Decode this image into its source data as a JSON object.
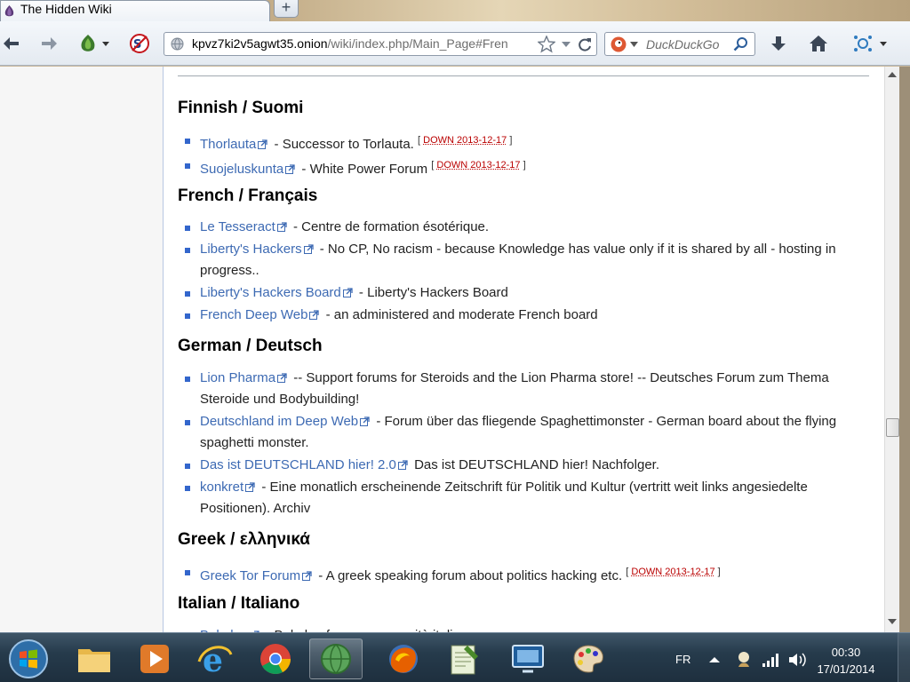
{
  "tab": {
    "title": "The Hidden Wiki",
    "new_tab_label": "+"
  },
  "navbar": {
    "url_host": "kpvz7ki2v5agwt35.onion",
    "url_path": "/wiki/index.php/Main_Page#Fren",
    "search_placeholder": "DuckDuckGo"
  },
  "sections": [
    {
      "heading": "Finnish / Suomi",
      "items": [
        {
          "link": "Thorlauta",
          "desc": " - Successor to Torlauta. ",
          "badge": "DOWN 2013-12-17"
        },
        {
          "link": "Suojeluskunta",
          "desc": " - White Power Forum ",
          "badge": "DOWN 2013-12-17"
        }
      ]
    },
    {
      "heading": "French / Français",
      "items": [
        {
          "link": "Le Tesseract",
          "desc": " - Centre de formation ésotérique."
        },
        {
          "link": "Liberty's Hackers",
          "desc": " - No CP, No racism - because Knowledge has value only if it is shared by all - hosting in progress.."
        },
        {
          "link": "Liberty's Hackers Board",
          "desc": " - Liberty's Hackers Board"
        },
        {
          "link": "French Deep Web",
          "desc": " - an administered and moderate French board"
        }
      ]
    },
    {
      "heading": "German / Deutsch",
      "items": [
        {
          "link": "Lion Pharma",
          "desc": " -- Support forums for Steroids and the Lion Pharma store! -- Deutsches Forum zum Thema Steroide und Bodybuilding!"
        },
        {
          "link": "Deutschland im Deep Web",
          "desc": " - Forum über das fliegende Spaghettimonster - German board about the flying spaghetti monster."
        },
        {
          "link": "Das ist DEUTSCHLAND hier! 2.0",
          "desc": " Das ist DEUTSCHLAND hier! Nachfolger."
        },
        {
          "link": "konkret",
          "desc": " - Eine monatlich erscheinende Zeitschrift für Politik und Kultur (vertritt weit links angesiedelte Positionen). Archiv"
        }
      ]
    },
    {
      "heading": "Greek / ελληνικά",
      "items": [
        {
          "link": "Greek Tor Forum",
          "desc": " - A greek speaking forum about politics hacking etc. ",
          "badge": "DOWN 2013-12-17"
        }
      ]
    },
    {
      "heading": "Italian / Italiano",
      "items": [
        {
          "link": "Babylon",
          "desc": " - Babylon forum e comunità italiana"
        }
      ]
    }
  ],
  "badge_prefix": "[",
  "badge_suffix": "]",
  "taskbar": {
    "lang": "FR",
    "time": "00:30",
    "date": "17/01/2014"
  },
  "colors": {
    "link": "#3d6ab3",
    "badge": "#ba0000",
    "bullet": "#3366cc"
  }
}
